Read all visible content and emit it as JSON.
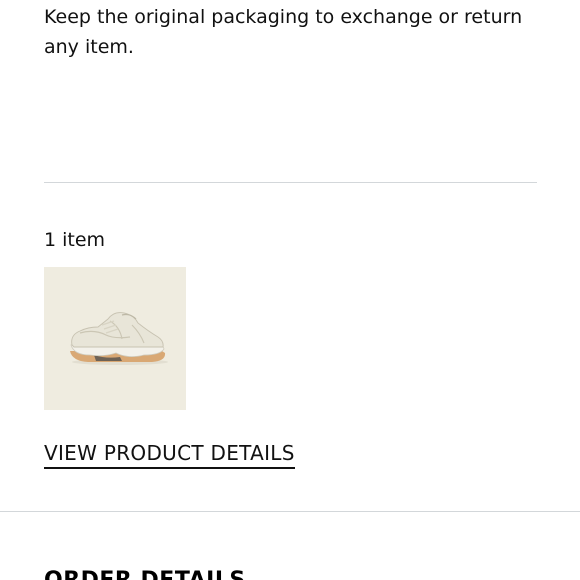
{
  "returns": {
    "note": "Keep the original packaging to exchange or return any item."
  },
  "order_items": {
    "count_label": "1 item",
    "products": [
      {
        "thumbnail_icon": "sneaker-image",
        "thumbnail_bg": "#efece0"
      }
    ],
    "view_details_label": "VIEW PRODUCT DETAILS"
  },
  "order_details": {
    "heading": "ORDER DETAILS"
  },
  "colors": {
    "text": "#111111",
    "divider": "#d3d7da",
    "thumbnail_bg": "#efece0"
  }
}
